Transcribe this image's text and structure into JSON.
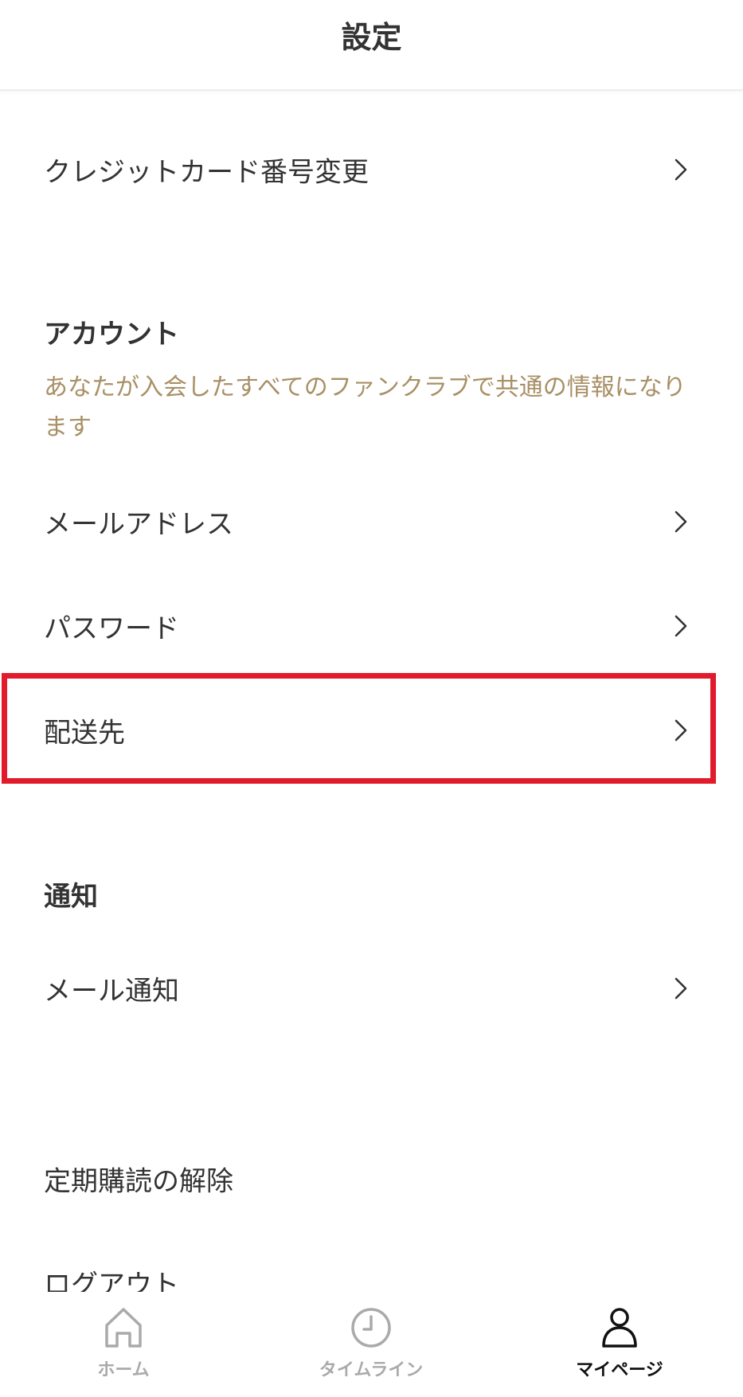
{
  "header": {
    "title": "設定"
  },
  "rows": {
    "credit_card": "クレジットカード番号変更",
    "email": "メールアドレス",
    "password": "パスワード",
    "shipping": "配送先",
    "mail_notification": "メール通知",
    "unsubscribe": "定期購読の解除",
    "logout": "ログアウト"
  },
  "sections": {
    "account": {
      "title": "アカウント",
      "note": "あなたが入会したすべてのファンクラブで共通の情報になります"
    },
    "notification": {
      "title": "通知"
    }
  },
  "tabbar": {
    "home": {
      "label": "ホーム",
      "icon": "home-icon"
    },
    "timeline": {
      "label": "タイムライン",
      "icon": "clock-icon"
    },
    "mypage": {
      "label": "マイページ",
      "icon": "person-icon",
      "active": true
    }
  },
  "colors": {
    "text": "#333333",
    "note": "#a89066",
    "highlight": "#e21b2c",
    "tab_inactive": "#aaaaaa",
    "tab_active": "#111111"
  }
}
